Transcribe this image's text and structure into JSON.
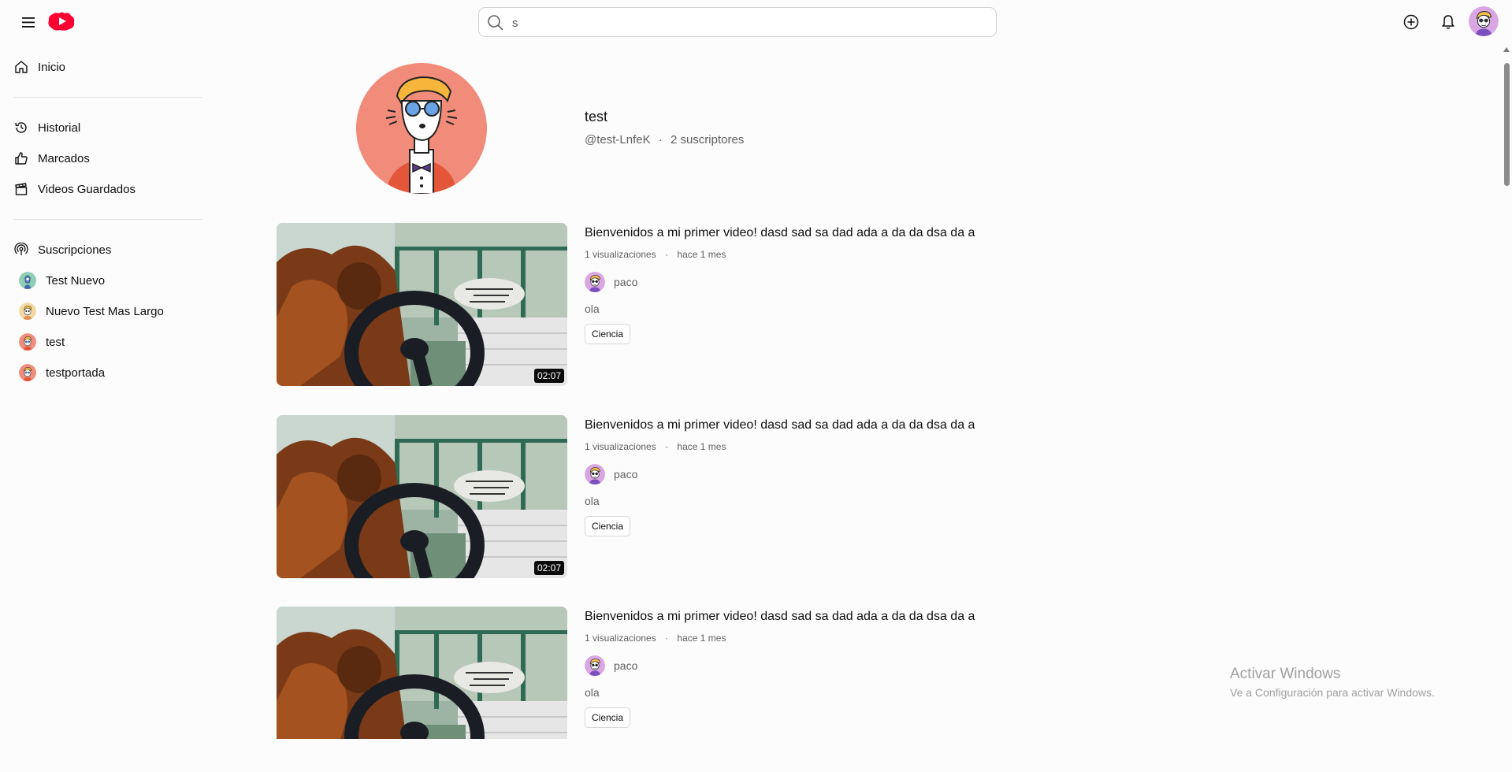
{
  "header": {
    "search_value": "s",
    "colors": {
      "brand": "#ff0000",
      "text": "#0f0f0f",
      "muted": "#606060"
    }
  },
  "sidebar": {
    "nav": [
      {
        "label": "Inicio",
        "icon": "home-icon"
      }
    ],
    "library": [
      {
        "label": "Historial",
        "icon": "history-icon"
      },
      {
        "label": "Marcados",
        "icon": "thumbs-up-icon"
      },
      {
        "label": "Videos Guardados",
        "icon": "clapperboard-icon"
      }
    ],
    "subscriptions_label": "Suscripciones",
    "subscriptions": [
      {
        "label": "Test Nuevo"
      },
      {
        "label": "Nuevo Test Mas Largo"
      },
      {
        "label": "test"
      },
      {
        "label": "testportada"
      }
    ]
  },
  "channel": {
    "name": "test",
    "handle": "@test-LnfeK",
    "separator": "·",
    "subscribers": "2 suscriptores"
  },
  "videos": [
    {
      "title": "Bienvenidos a mi primer video! dasd sad sa dad ada a da da dsa da a",
      "views": "1 visualizaciones",
      "age": "hace 1 mes",
      "author": "paco",
      "description": "ola",
      "tag": "Ciencia",
      "duration": "02:07"
    },
    {
      "title": "Bienvenidos a mi primer video! dasd sad sa dad ada a da da dsa da a",
      "views": "1 visualizaciones",
      "age": "hace 1 mes",
      "author": "paco",
      "description": "ola",
      "tag": "Ciencia",
      "duration": "02:07"
    },
    {
      "title": "Bienvenidos a mi primer video! dasd sad sa dad ada a da da dsa da a",
      "views": "1 visualizaciones",
      "age": "hace 1 mes",
      "author": "paco",
      "description": "ola",
      "tag": "Ciencia",
      "duration": ""
    }
  ],
  "watermark": {
    "line1": "Activar Windows",
    "line2": "Ve a Configuración para activar Windows."
  }
}
